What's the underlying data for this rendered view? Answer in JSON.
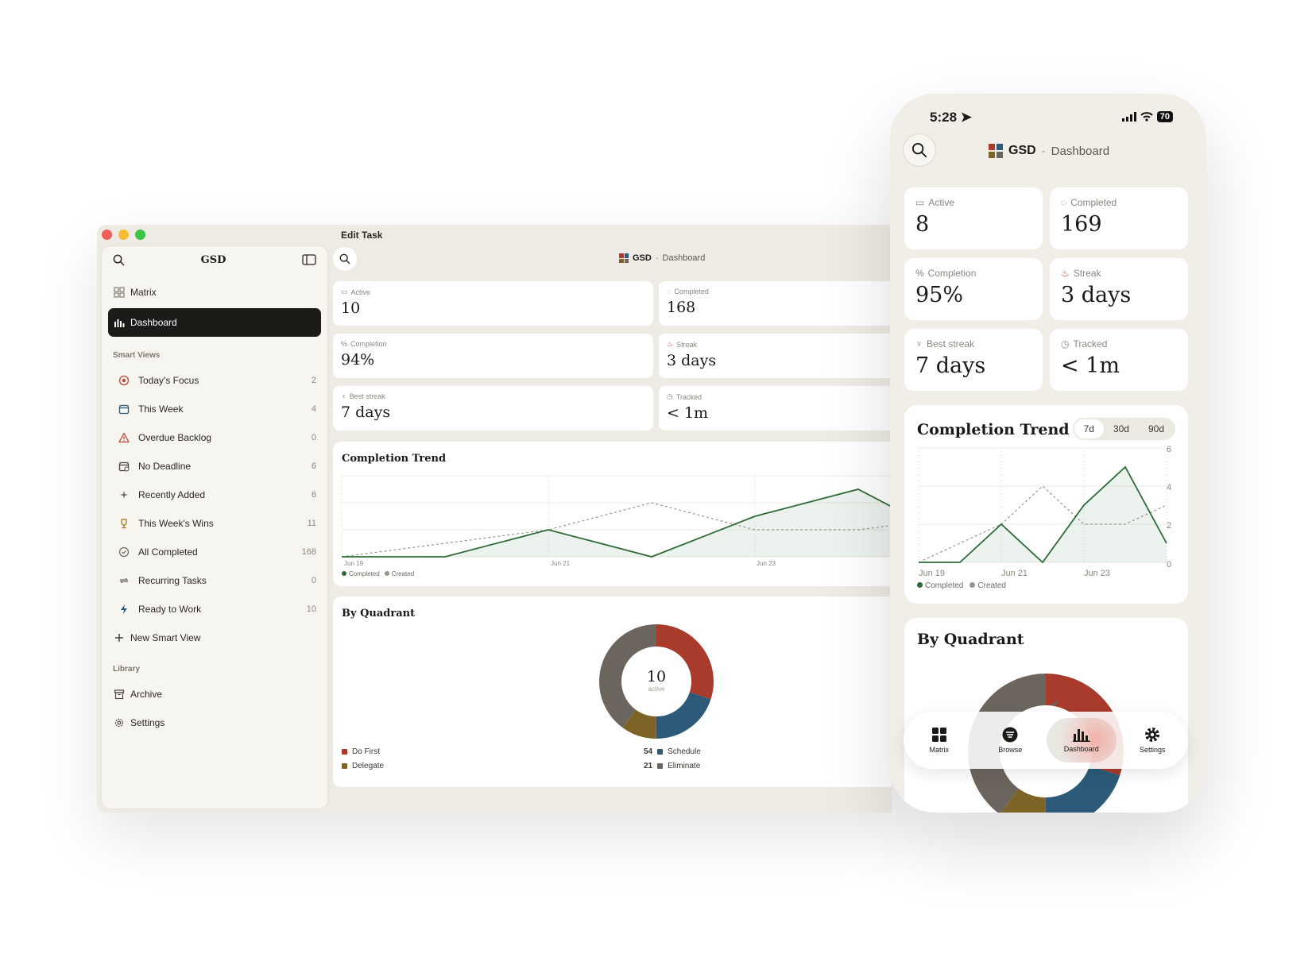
{
  "colors": {
    "accent_green": "#2e6b3a",
    "do_first": "#a83b2c",
    "schedule": "#2c5a78",
    "delegate": "#7d6426",
    "eliminate": "#6b655d",
    "dark": "#1d1b18"
  },
  "desktop": {
    "window_title": "Edit Task",
    "sidebar": {
      "title": "GSD",
      "nav": [
        {
          "label": "Matrix",
          "icon": "grid-icon"
        },
        {
          "label": "Dashboard",
          "icon": "bar-chart-icon"
        }
      ],
      "smart_views_title": "Smart Views",
      "smart_views": [
        {
          "label": "Today's Focus",
          "count": "2",
          "icon": "target-icon"
        },
        {
          "label": "This Week",
          "count": "4",
          "icon": "calendar-icon"
        },
        {
          "label": "Overdue Backlog",
          "count": "0",
          "icon": "warning-icon"
        },
        {
          "label": "No Deadline",
          "count": "6",
          "icon": "calendar-off-icon"
        },
        {
          "label": "Recently Added",
          "count": "6",
          "icon": "sparkle-icon"
        },
        {
          "label": "This Week's Wins",
          "count": "11",
          "icon": "trophy-icon"
        },
        {
          "label": "All Completed",
          "count": "168",
          "icon": "check-circle-icon"
        },
        {
          "label": "Recurring Tasks",
          "count": "0",
          "icon": "repeat-icon"
        },
        {
          "label": "Ready to Work",
          "count": "10",
          "icon": "bolt-icon"
        }
      ],
      "new_smart_view": "New Smart View",
      "library_title": "Library",
      "library": [
        {
          "label": "Archive",
          "icon": "archive-icon"
        },
        {
          "label": "Settings",
          "icon": "gear-icon"
        }
      ]
    },
    "header": {
      "brand": "GSD",
      "separator": "-",
      "subtitle": "Dashboard"
    },
    "stats": [
      {
        "label": "Active",
        "value": "10",
        "icon": "inbox-icon"
      },
      {
        "label": "Completed",
        "value": "168",
        "icon": "check-circle-icon"
      },
      {
        "label": "Completion",
        "value": "94%",
        "icon": "percent-icon"
      },
      {
        "label": "Streak",
        "value": "3 days",
        "icon": "flame-icon"
      },
      {
        "label": "Best streak",
        "value": "7 days",
        "icon": "trophy-icon"
      },
      {
        "label": "Tracked",
        "value": "< 1m",
        "icon": "clock-icon"
      }
    ],
    "trend": {
      "title": "Completion Trend",
      "x_ticks": [
        "Jun 19",
        "Jun 21",
        "Jun 23"
      ],
      "legend_completed": "Completed",
      "legend_created": "Created"
    },
    "quadrant": {
      "title": "By Quadrant",
      "center_value": "10",
      "center_label": "active",
      "legend": [
        {
          "label": "Do First",
          "value": ""
        },
        {
          "label": "Schedule",
          "value": "54"
        },
        {
          "label": "Delegate",
          "value": ""
        },
        {
          "label": "Eliminate",
          "value": "21"
        }
      ]
    }
  },
  "phone": {
    "time": "5:28",
    "battery": "70",
    "header": {
      "brand": "GSD",
      "separator": "-",
      "subtitle": "Dashboard"
    },
    "stats": [
      {
        "label": "Active",
        "value": "8",
        "icon": "inbox-icon"
      },
      {
        "label": "Completed",
        "value": "169",
        "icon": "check-circle-icon"
      },
      {
        "label": "Completion",
        "value": "95%",
        "icon": "percent-icon"
      },
      {
        "label": "Streak",
        "value": "3 days",
        "icon": "flame-icon"
      },
      {
        "label": "Best streak",
        "value": "7 days",
        "icon": "trophy-icon"
      },
      {
        "label": "Tracked",
        "value": "< 1m",
        "icon": "clock-icon"
      }
    ],
    "trend": {
      "title": "Completion Trend",
      "ranges": [
        "7d",
        "30d",
        "90d"
      ],
      "selected_range": "7d",
      "y_ticks": [
        "6",
        "4",
        "2",
        "0"
      ],
      "x_ticks": [
        "Jun 19",
        "Jun 21",
        "Jun 23"
      ],
      "legend_completed": "Completed",
      "legend_created": "Created"
    },
    "quadrant": {
      "title": "By Quadrant"
    },
    "tabs": [
      {
        "label": "Matrix",
        "icon": "grid-icon"
      },
      {
        "label": "Browse",
        "icon": "list-circle-icon"
      },
      {
        "label": "Dashboard",
        "icon": "bar-chart-icon"
      },
      {
        "label": "Settings",
        "icon": "gear-icon"
      }
    ]
  },
  "chart_data": [
    {
      "type": "line",
      "title": "Completion Trend",
      "x": [
        "Jun 19",
        "Jun 20",
        "Jun 21",
        "Jun 22",
        "Jun 23",
        "Jun 24",
        "Jun 25"
      ],
      "series": [
        {
          "name": "Completed",
          "values": [
            0,
            0,
            2,
            0,
            3,
            5,
            1
          ]
        },
        {
          "name": "Created",
          "values": [
            0,
            1,
            2,
            4,
            2,
            2,
            3
          ]
        }
      ],
      "ylim": [
        0,
        6
      ]
    },
    {
      "type": "pie",
      "title": "By Quadrant",
      "categories": [
        "Do First",
        "Schedule",
        "Delegate",
        "Eliminate"
      ],
      "values": [
        3,
        2,
        1,
        4
      ]
    }
  ]
}
